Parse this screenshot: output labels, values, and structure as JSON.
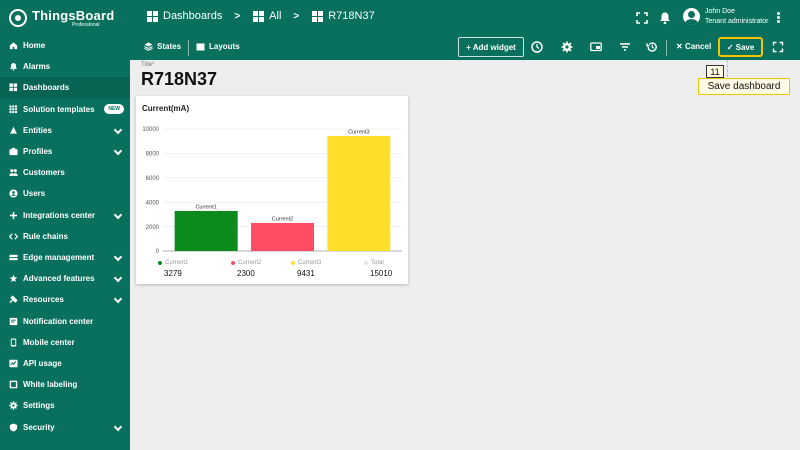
{
  "app": {
    "brand": "ThingsBoard",
    "brand_sub": "Professional"
  },
  "breadcrumb": [
    "Dashboards",
    "All",
    "R718N37"
  ],
  "user": {
    "name": "John Doe",
    "role": "Tenant administrator"
  },
  "sidebar": {
    "items": [
      {
        "label": "Home",
        "icon": "home-icon",
        "chevron": false
      },
      {
        "label": "Alarms",
        "icon": "alarm-icon",
        "chevron": false
      },
      {
        "label": "Dashboards",
        "icon": "dashboard-icon",
        "chevron": false,
        "active": true
      },
      {
        "label": "Solution templates",
        "icon": "grid-icon",
        "chevron": false,
        "badge": "NEW"
      },
      {
        "label": "Entities",
        "icon": "entities-icon",
        "chevron": true
      },
      {
        "label": "Profiles",
        "icon": "profiles-icon",
        "chevron": true
      },
      {
        "label": "Customers",
        "icon": "customers-icon",
        "chevron": false
      },
      {
        "label": "Users",
        "icon": "users-icon",
        "chevron": false
      },
      {
        "label": "Integrations center",
        "icon": "integrations-icon",
        "chevron": true
      },
      {
        "label": "Rule chains",
        "icon": "rule-chains-icon",
        "chevron": false
      },
      {
        "label": "Edge management",
        "icon": "edge-icon",
        "chevron": true
      },
      {
        "label": "Advanced features",
        "icon": "advanced-icon",
        "chevron": true
      },
      {
        "label": "Resources",
        "icon": "resources-icon",
        "chevron": true
      },
      {
        "label": "Notification center",
        "icon": "notification-icon",
        "chevron": false
      },
      {
        "label": "Mobile center",
        "icon": "mobile-icon",
        "chevron": false
      },
      {
        "label": "API usage",
        "icon": "api-icon",
        "chevron": false
      },
      {
        "label": "White labeling",
        "icon": "white-label-icon",
        "chevron": false
      },
      {
        "label": "Settings",
        "icon": "settings-icon",
        "chevron": false
      },
      {
        "label": "Security",
        "icon": "security-icon",
        "chevron": true
      }
    ]
  },
  "toolbar": {
    "states": "States",
    "layouts": "Layouts",
    "add_widget": "+ Add widget",
    "cancel": "Cancel",
    "save": "Save"
  },
  "callout": {
    "number": "11",
    "label": "Save dashboard"
  },
  "dashboard": {
    "title_label": "Title*",
    "title": "R718N37"
  },
  "widget": {
    "title": "Current(mA)"
  },
  "colors": {
    "brand": "#08705c",
    "highlight": "#f5c400"
  },
  "chart_data": {
    "type": "bar",
    "title": "Current(mA)",
    "categories": [
      "Current1",
      "Current2",
      "Current3"
    ],
    "values": [
      3279,
      2300,
      9431
    ],
    "colors": [
      "#0b8a1e",
      "#ff4d64",
      "#ffdf2c"
    ],
    "ylim": [
      0,
      10000
    ],
    "yticks": [
      0,
      2000,
      4000,
      6000,
      8000,
      10000
    ],
    "legend": [
      {
        "name": "Current1",
        "value": "3279",
        "color": "#0b8a1e"
      },
      {
        "name": "Current2",
        "value": "2300",
        "color": "#ff4d64"
      },
      {
        "name": "Current3",
        "value": "9431",
        "color": "#ffdf2c"
      },
      {
        "name": "Total",
        "value": "15010",
        "color": "#e5e5e5"
      }
    ]
  }
}
